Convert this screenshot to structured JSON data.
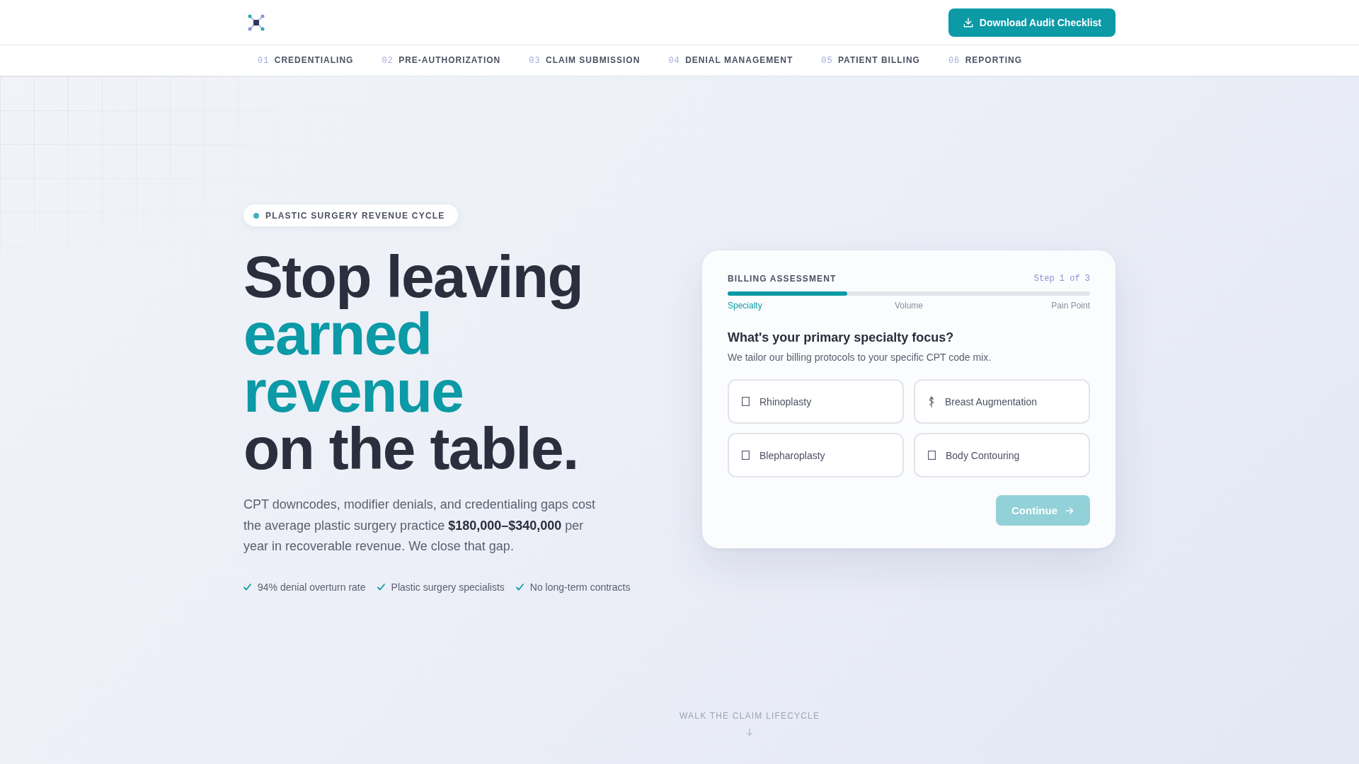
{
  "header": {
    "cta": {
      "label": "Download Audit Checklist"
    }
  },
  "nav": [
    {
      "number": "01",
      "label": "CREDENTIALING"
    },
    {
      "number": "02",
      "label": "PRE-AUTHORIZATION"
    },
    {
      "number": "03",
      "label": "CLAIM SUBMISSION"
    },
    {
      "number": "04",
      "label": "DENIAL MANAGEMENT"
    },
    {
      "number": "05",
      "label": "PATIENT BILLING"
    },
    {
      "number": "06",
      "label": "REPORTING"
    }
  ],
  "hero": {
    "badge": "PLASTIC SURGERY REVENUE CYCLE",
    "headline": {
      "lead": "Stop leaving",
      "accent": "earned revenue",
      "tail": "on the table."
    },
    "intro": "CPT downcodes, modifier denials, and credentialing gaps cost the average plastic surgery practice **$180,000–$340,000** per year in recoverable revenue. We close that gap.",
    "highlights": [
      "94% denial overturn rate",
      "Plastic surgery specialists",
      "No long-term contracts"
    ]
  },
  "assessment": {
    "title": "BILLING ASSESSMENT",
    "step_counter": "Step 1 of 3",
    "progress": {
      "level": 0.33
    },
    "steps": [
      {
        "label": "Specialty",
        "current": true
      },
      {
        "label": "Volume",
        "current": false
      },
      {
        "label": "Pain Point",
        "current": false
      }
    ],
    "question": "What's your primary specialty focus?",
    "hint": "We tailor our billing protocols to your specific CPT code mix.",
    "options": [
      {
        "label": "Rhinoplasty",
        "kind": "blank",
        "selected": false
      },
      {
        "label": "Breast Augmentation",
        "kind": "staff",
        "selected": false
      },
      {
        "label": "Blepharoplasty",
        "kind": "blank",
        "selected": false
      },
      {
        "label": "Body Contouring",
        "kind": "blank",
        "selected": false
      }
    ],
    "continue_button": {
      "label": "Continue",
      "disabled": true
    }
  },
  "scroll_cue": "WALK THE CLAIM LIFECYCLE"
}
